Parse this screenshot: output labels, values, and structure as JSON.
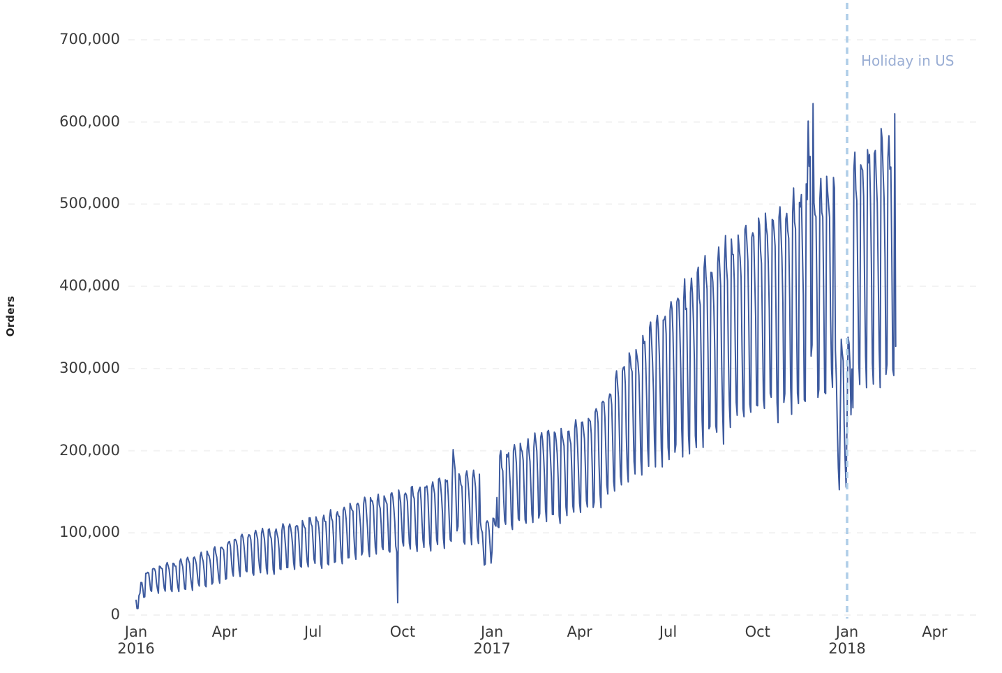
{
  "chart_data": {
    "type": "line",
    "title": "",
    "subtitle": "",
    "xlabel": "",
    "ylabel": "Orders",
    "ylim": [
      0,
      735000
    ],
    "xlim": [
      "2015-12-27",
      "2018-04-10"
    ],
    "grid": true,
    "grid_axis": "y",
    "grid_style": "dotted",
    "legend_position": "none",
    "y_ticks": [
      0,
      100000,
      200000,
      300000,
      400000,
      500000,
      600000,
      700000
    ],
    "y_tick_labels": [
      "0",
      "100,000",
      "200,000",
      "300,000",
      "400,000",
      "500,000",
      "600,000",
      "700,000"
    ],
    "x_ticks": [
      {
        "month": "Jan",
        "year": "2016",
        "date": "2016-01-01"
      },
      {
        "month": "Apr",
        "year": "",
        "date": "2016-04-01"
      },
      {
        "month": "Jul",
        "year": "",
        "date": "2016-07-01"
      },
      {
        "month": "Oct",
        "year": "",
        "date": "2016-10-01"
      },
      {
        "month": "Jan",
        "year": "2017",
        "date": "2017-01-01"
      },
      {
        "month": "Apr",
        "year": "",
        "date": "2017-04-01"
      },
      {
        "month": "Jul",
        "year": "",
        "date": "2017-07-01"
      },
      {
        "month": "Oct",
        "year": "",
        "date": "2017-10-01"
      },
      {
        "month": "Jan",
        "year": "2018",
        "date": "2018-01-01"
      },
      {
        "month": "Apr",
        "year": "",
        "date": "2018-04-01"
      }
    ],
    "series": [
      {
        "name": "Orders",
        "color": "#3d5a9e",
        "line_width": 2,
        "frequency": "daily",
        "seasonality": "weekly (weekend troughs, weekday peaks)",
        "start_date": "2016-01-01",
        "end_date": "2018-02-20",
        "description": "Daily order counts trending upward from about 40,000 to about 600,000 with strong weekly oscillation whose amplitude grows over time.",
        "trend_baseline": [
          {
            "date": "2016-01-01",
            "value": 22000
          },
          {
            "date": "2016-01-15",
            "value": 42000
          },
          {
            "date": "2016-02-15",
            "value": 48000
          },
          {
            "date": "2016-03-15",
            "value": 56000
          },
          {
            "date": "2016-04-15",
            "value": 72000
          },
          {
            "date": "2016-05-15",
            "value": 78000
          },
          {
            "date": "2016-06-15",
            "value": 84000
          },
          {
            "date": "2016-07-15",
            "value": 92000
          },
          {
            "date": "2016-08-15",
            "value": 104000
          },
          {
            "date": "2016-09-15",
            "value": 112000
          },
          {
            "date": "2016-10-15",
            "value": 118000
          },
          {
            "date": "2016-11-15",
            "value": 124000
          },
          {
            "date": "2016-12-15",
            "value": 132000
          },
          {
            "date": "2017-01-15",
            "value": 150000
          },
          {
            "date": "2017-02-15",
            "value": 166000
          },
          {
            "date": "2017-03-15",
            "value": 170000
          },
          {
            "date": "2017-04-15",
            "value": 186000
          },
          {
            "date": "2017-05-15",
            "value": 232000
          },
          {
            "date": "2017-06-15",
            "value": 268000
          },
          {
            "date": "2017-07-15",
            "value": 296000
          },
          {
            "date": "2017-08-15",
            "value": 324000
          },
          {
            "date": "2017-09-15",
            "value": 348000
          },
          {
            "date": "2017-10-15",
            "value": 368000
          },
          {
            "date": "2017-11-15",
            "value": 388000
          },
          {
            "date": "2017-12-15",
            "value": 392000
          },
          {
            "date": "2018-01-15",
            "value": 412000
          },
          {
            "date": "2018-02-20",
            "value": 440000
          }
        ],
        "weekly_amplitude": [
          {
            "date": "2016-01-01",
            "value": 14000
          },
          {
            "date": "2016-06-15",
            "value": 28000
          },
          {
            "date": "2016-12-15",
            "value": 42000
          },
          {
            "date": "2017-04-15",
            "value": 56000
          },
          {
            "date": "2017-08-15",
            "value": 108000
          },
          {
            "date": "2017-12-15",
            "value": 132000
          },
          {
            "date": "2018-02-20",
            "value": 152000
          }
        ],
        "notable_points": [
          {
            "date": "2016-01-01",
            "value": 18000,
            "note": "series start, low"
          },
          {
            "date": "2016-09-26",
            "value": 15000,
            "note": "sharp single-day outlier dip"
          },
          {
            "date": "2016-12-25",
            "value": 62000,
            "note": "christmas holiday trough"
          },
          {
            "date": "2017-01-01",
            "value": 78000,
            "note": "new year trough"
          },
          {
            "date": "2017-01-10",
            "value": 200000,
            "note": "post-holiday peak"
          },
          {
            "date": "2017-11-24",
            "value": 558000,
            "note": "late-november peak"
          },
          {
            "date": "2017-12-25",
            "value": 243000,
            "note": "christmas trough"
          },
          {
            "date": "2018-01-01",
            "value": 240000,
            "note": "new year trough at holiday marker"
          },
          {
            "date": "2018-02-05",
            "value": 592000,
            "note": "february peak"
          },
          {
            "date": "2018-02-19",
            "value": 610000,
            "note": "series maximum"
          },
          {
            "date": "2018-02-20",
            "value": 327000,
            "note": "final partial value"
          }
        ],
        "min_value": 15000,
        "max_value": 610000
      }
    ],
    "annotations": [
      {
        "type": "vline",
        "label": "Holiday in US",
        "date": "2018-01-01",
        "line_style": "dashed",
        "line_color": "#aecde8",
        "label_color": "#9aaed4",
        "label_position": "right"
      }
    ],
    "colors": {
      "series": "#3d5a9e",
      "gridline": "#f2f2f2",
      "tick_text": "#3a3a3a",
      "axis_title": "#222222",
      "annotation_line": "#aecde8",
      "annotation_text": "#9aaed4",
      "background": "#ffffff"
    }
  }
}
